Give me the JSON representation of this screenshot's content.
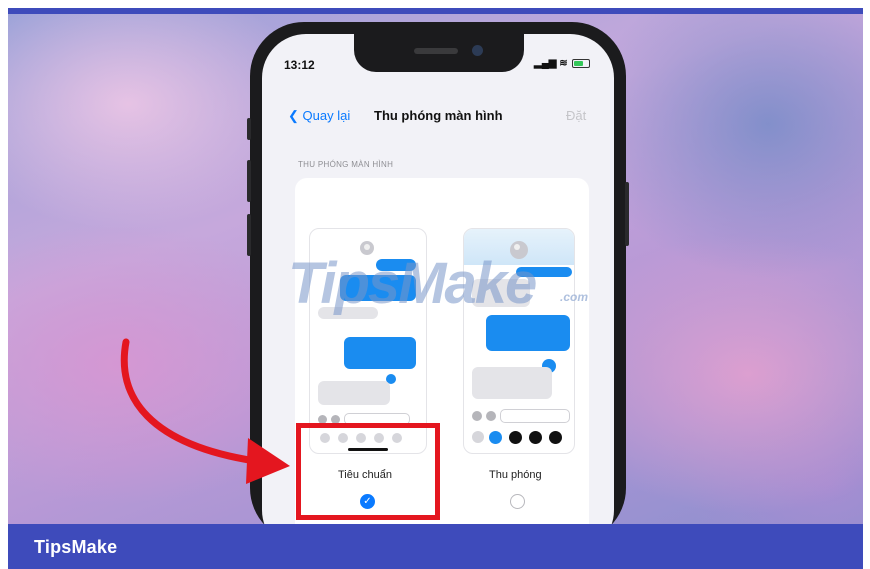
{
  "phone": {
    "status_time": "13:12",
    "nav_back": "Quay lại",
    "nav_title": "Thu phóng màn hình",
    "nav_action": "Đặt",
    "section_header": "THU PHÓNG MÀN HÌNH",
    "options": [
      {
        "label": "Tiêu chuẩn",
        "selected": true
      },
      {
        "label": "Thu phóng",
        "selected": false
      }
    ]
  },
  "watermark": {
    "main": "TipsMake",
    "suffix": ".com"
  },
  "footer": {
    "brand": "TipsMake"
  },
  "colors": {
    "accent": "#0a7aff",
    "highlight": "#e4161f",
    "bar": "#3e4bbb",
    "bubble": "#1a8cf0"
  },
  "icons": [
    "chevron-left-icon",
    "signal-icon",
    "wifi-icon",
    "battery-icon",
    "checkmark-icon",
    "arrow-icon"
  ]
}
